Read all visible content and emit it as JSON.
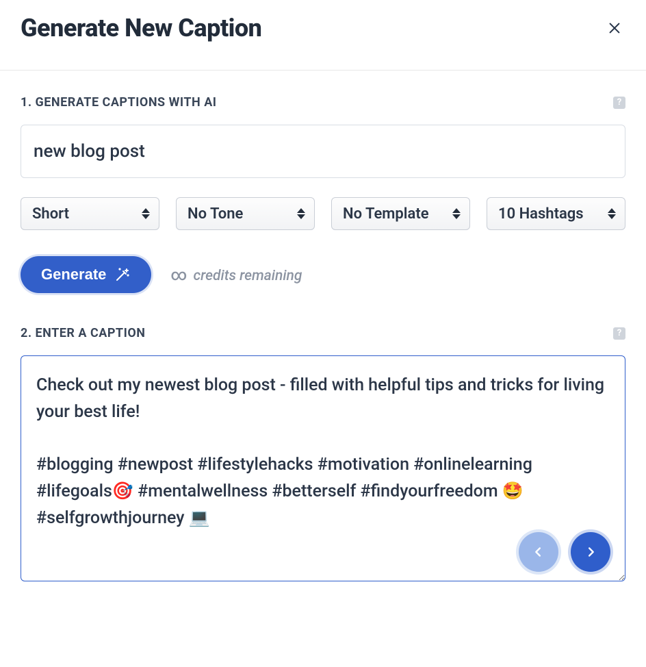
{
  "modal": {
    "title": "Generate New Caption"
  },
  "section1": {
    "label": "1. GENERATE CAPTIONS WITH AI",
    "prompt_value": "new blog post",
    "selects": {
      "length": "Short",
      "tone": "No Tone",
      "template": "No Template",
      "hashtags": "10 Hashtags"
    },
    "generate_label": "Generate",
    "credits_symbol": "∞",
    "credits_text": "credits remaining"
  },
  "section2": {
    "label": "2. ENTER A CAPTION",
    "caption_value": "Check out my newest blog post - filled with helpful tips and tricks for living your best life!\n\n#blogging #newpost #lifestylehacks #motivation #onlinelearning #lifegoals🎯 #mentalwellness #betterself #findyourfreedom 🤩#selfgrowthjourney 💻"
  }
}
